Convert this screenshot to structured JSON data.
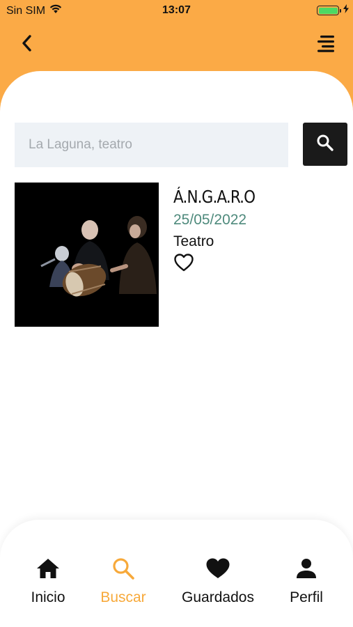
{
  "status_bar": {
    "carrier": "Sin SIM",
    "time": "13:07",
    "battery_level": 1.0
  },
  "header": {
    "back_icon": "chevron-left-icon",
    "menu_icon": "menu-icon"
  },
  "search": {
    "placeholder": "La Laguna, teatro",
    "value": "",
    "button_icon": "search-icon"
  },
  "results": [
    {
      "title": "Á.N.G.A.R.O",
      "date": "25/05/2022",
      "category": "Teatro",
      "favorite": false
    }
  ],
  "tab_bar": {
    "tabs": [
      {
        "label": "Inicio",
        "icon": "home-icon",
        "active": false
      },
      {
        "label": "Buscar",
        "icon": "search-icon",
        "active": true
      },
      {
        "label": "Guardados",
        "icon": "heart-icon",
        "active": false
      },
      {
        "label": "Perfil",
        "icon": "person-icon",
        "active": false
      }
    ]
  },
  "colors": {
    "header_orange": "#FBAA46",
    "active_tab": "#F7A93A",
    "date_green": "#4E8A7C",
    "search_field_bg": "#EEF2F6",
    "search_button_bg": "#1A1A1A"
  }
}
